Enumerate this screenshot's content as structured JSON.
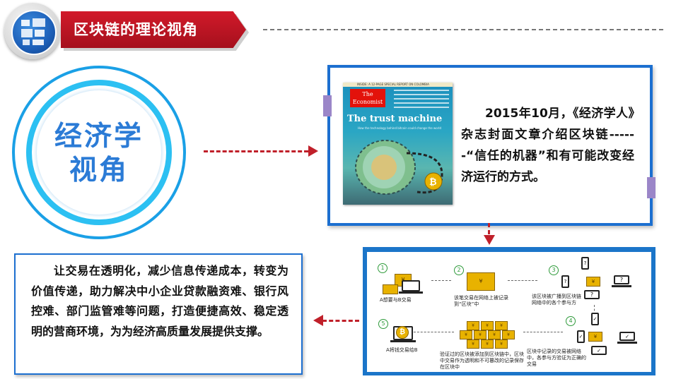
{
  "header": {
    "title": "区块链的理论视角"
  },
  "circle": {
    "line1": "经济学",
    "line2": "视角"
  },
  "magazine": {
    "inside_line": "INSIDE: A 12-PAGE SPECIAL REPORT ON COLOMBIA",
    "brand_line1": "The",
    "brand_line2": "Economist",
    "cover_title": "The trust machine",
    "cover_subtitle": "How the technology behind bitcoin could change the world"
  },
  "top_box": {
    "text": "2015年10月，《经济学人》杂志封面文章介绍区块链------“信任的机器”和有可能改变经济运行的方式。"
  },
  "bottom_box": {
    "text": "让交易在透明化，减少信息传递成本，转变为价值传递，助力解决中小企业贷款融资难、银行风控难、部门监管难等问题，打造便捷高效、稳定透明的营商环境，为为经济高质量发展提供支撑。"
  },
  "diagram": {
    "steps": [
      {
        "num": "1",
        "label": "A想要与B交易"
      },
      {
        "num": "2",
        "label": "该笔交易在网络上被记录到“区块”中"
      },
      {
        "num": "3",
        "label": "该区块被广播到区块链网络中的各个参与方"
      },
      {
        "num": "4",
        "label": "区块中记录的交易被网络中，各参与方验证为正确的交易"
      },
      {
        "num": "5",
        "label": "A将钱交易给B"
      }
    ],
    "middle_label": "验证过的区块被添加到区块链中，区块中交易作为透明和不可篡改的记录保存在区块中",
    "laptop_mark": "?",
    "coin_symbol": "₿"
  }
}
